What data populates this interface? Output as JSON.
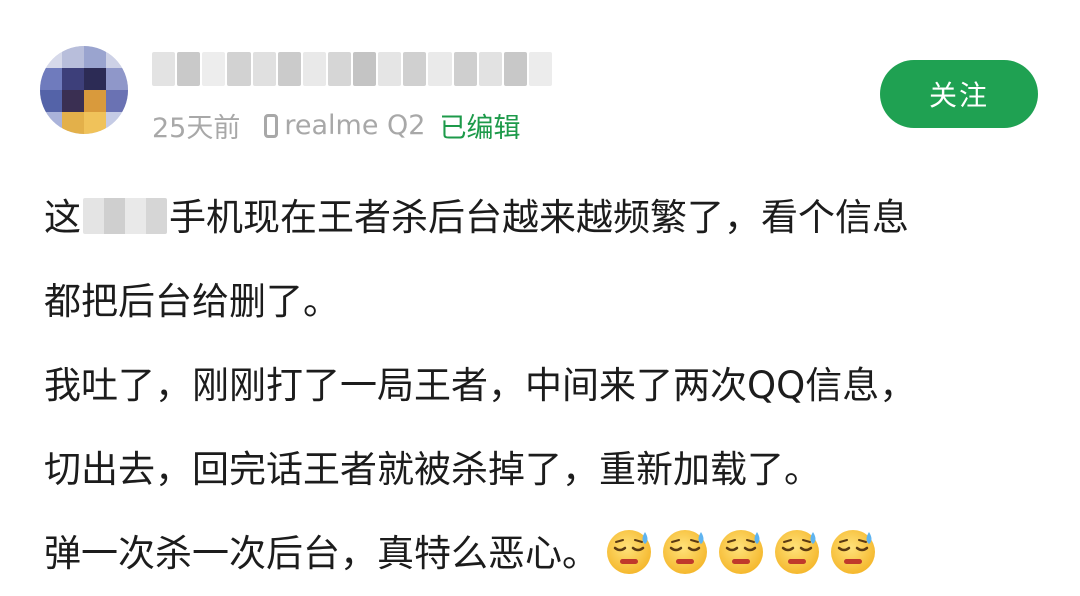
{
  "post": {
    "time": "25天前",
    "device": "realme Q2",
    "edited": "已编辑",
    "follow_label": "关注"
  },
  "content": {
    "line1_prefix": "这",
    "line1_suffix": "手机现在王者杀后台越来越频繁了，看个信息",
    "line2": "都把后台给删了。",
    "line3": "我吐了，刚刚打了一局王者，中间来了两次QQ信息，",
    "line4": "切出去，回完话王者就被杀掉了，重新加载了。",
    "line5": "弹一次杀一次后台，真特么恶心。"
  },
  "emojis": {
    "count": 5,
    "icon": "downcast-face-with-sweat-icon"
  },
  "colors": {
    "accent_green": "#1fa152",
    "edited_green": "#1d9a4a",
    "meta_gray": "#a8a8a8",
    "text": "#1c1c1c"
  }
}
